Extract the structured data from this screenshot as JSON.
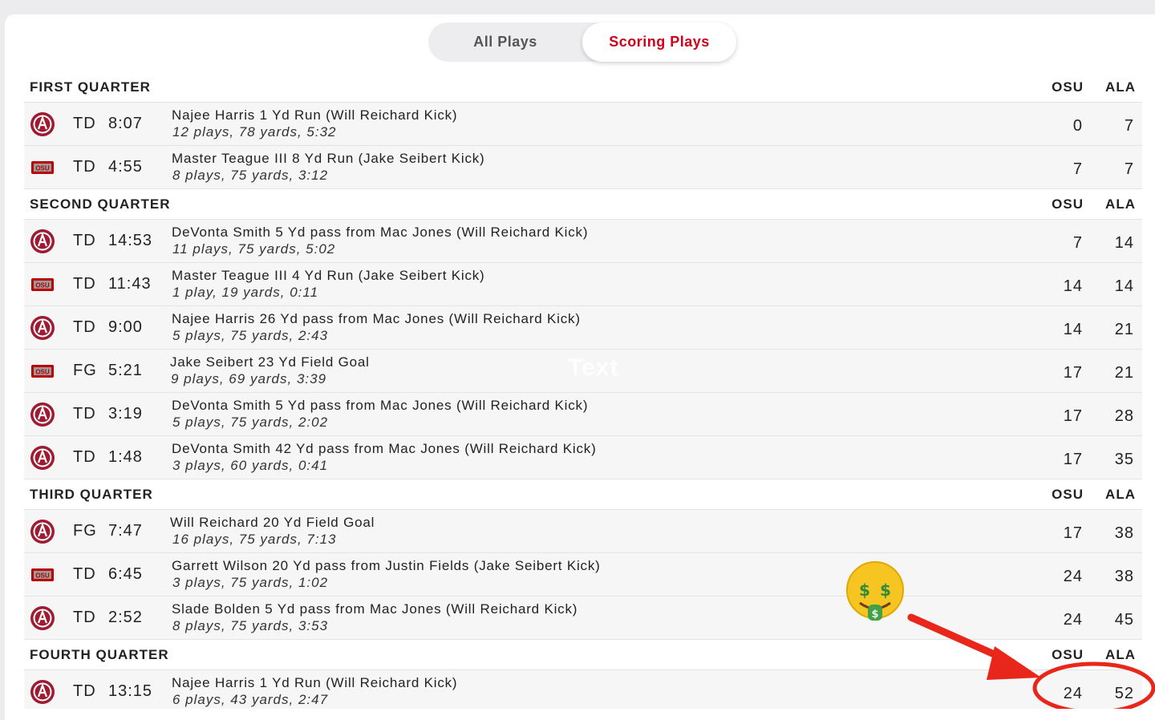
{
  "tabs": {
    "all_plays": "All Plays",
    "scoring_plays": "Scoring Plays"
  },
  "team_columns": {
    "osu": "OSU",
    "ala": "ALA"
  },
  "watermark": "Text",
  "colors": {
    "accent": "#d0021b",
    "alabama_crimson": "#9e1b32",
    "ohio_state_scarlet": "#bb0000"
  },
  "quarters": [
    {
      "title": "FIRST QUARTER",
      "osu": "OSU",
      "ala": "ALA",
      "plays": [
        {
          "team_icon": "alabama-logo-icon",
          "type": "TD",
          "time": "8:07",
          "desc": "Najee Harris 1 Yd Run (Will Reichard Kick)",
          "drive": "12 plays, 78 yards, 5:32",
          "osu": "0",
          "ala": "7"
        },
        {
          "team_icon": "ohio-state-logo-icon",
          "type": "TD",
          "time": "4:55",
          "desc": "Master Teague III 8 Yd Run (Jake Seibert Kick)",
          "drive": "8 plays, 75 yards, 3:12",
          "osu": "7",
          "ala": "7"
        }
      ]
    },
    {
      "title": "SECOND QUARTER",
      "osu": "OSU",
      "ala": "ALA",
      "plays": [
        {
          "team_icon": "alabama-logo-icon",
          "type": "TD",
          "time": "14:53",
          "desc": "DeVonta Smith 5 Yd pass from Mac Jones (Will Reichard Kick)",
          "drive": "11 plays, 75 yards, 5:02",
          "osu": "7",
          "ala": "14"
        },
        {
          "team_icon": "ohio-state-logo-icon",
          "type": "TD",
          "time": "11:43",
          "desc": "Master Teague III 4 Yd Run (Jake Seibert Kick)",
          "drive": "1 play, 19 yards, 0:11",
          "osu": "14",
          "ala": "14"
        },
        {
          "team_icon": "alabama-logo-icon",
          "type": "TD",
          "time": "9:00",
          "desc": "Najee Harris 26 Yd pass from Mac Jones (Will Reichard Kick)",
          "drive": "5 plays, 75 yards, 2:43",
          "osu": "14",
          "ala": "21"
        },
        {
          "team_icon": "ohio-state-logo-icon",
          "type": "FG",
          "time": "5:21",
          "desc": "Jake Seibert 23 Yd Field Goal",
          "drive": "9 plays, 69 yards, 3:39",
          "osu": "17",
          "ala": "21"
        },
        {
          "team_icon": "alabama-logo-icon",
          "type": "TD",
          "time": "3:19",
          "desc": "DeVonta Smith 5 Yd pass from Mac Jones (Will Reichard Kick)",
          "drive": "5 plays, 75 yards, 2:02",
          "osu": "17",
          "ala": "28"
        },
        {
          "team_icon": "alabama-logo-icon",
          "type": "TD",
          "time": "1:48",
          "desc": "DeVonta Smith 42 Yd pass from Mac Jones (Will Reichard Kick)",
          "drive": "3 plays, 60 yards, 0:41",
          "osu": "17",
          "ala": "35"
        }
      ]
    },
    {
      "title": "THIRD QUARTER",
      "osu": "OSU",
      "ala": "ALA",
      "plays": [
        {
          "team_icon": "alabama-logo-icon",
          "type": "FG",
          "time": "7:47",
          "desc": "Will Reichard 20 Yd Field Goal",
          "drive": "16 plays, 75 yards, 7:13",
          "osu": "17",
          "ala": "38"
        },
        {
          "team_icon": "ohio-state-logo-icon",
          "type": "TD",
          "time": "6:45",
          "desc": "Garrett Wilson 20 Yd pass from Justin Fields (Jake Seibert Kick)",
          "drive": "3 plays, 75 yards, 1:02",
          "osu": "24",
          "ala": "38"
        },
        {
          "team_icon": "alabama-logo-icon",
          "type": "TD",
          "time": "2:52",
          "desc": "Slade Bolden 5 Yd pass from Mac Jones (Will Reichard Kick)",
          "drive": "8 plays, 75 yards, 3:53",
          "osu": "24",
          "ala": "45"
        }
      ]
    },
    {
      "title": "FOURTH QUARTER",
      "osu": "OSU",
      "ala": "ALA",
      "plays": [
        {
          "team_icon": "alabama-logo-icon",
          "type": "TD",
          "time": "13:15",
          "desc": "Najee Harris 1 Yd Run (Will Reichard Kick)",
          "drive": "6 plays, 43 yards, 2:47",
          "osu": "24",
          "ala": "52"
        }
      ]
    }
  ],
  "annotations": {
    "emoji_icon": "money-mouth-face-icon",
    "arrow_icon": "red-arrow-icon",
    "circle_icon": "red-circle-highlight-icon"
  }
}
